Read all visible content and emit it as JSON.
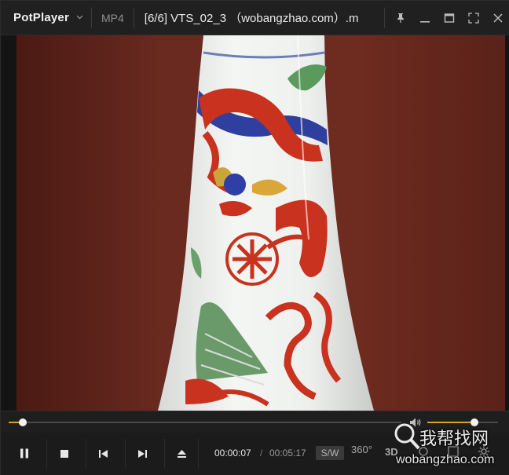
{
  "app": {
    "name": "PotPlayer",
    "format": "MP4",
    "title": "[6/6] VTS_02_3 （wobangzhao.com）.m"
  },
  "playback": {
    "current_time": "00:00:07",
    "separator": "/",
    "total_time": "00:05:17",
    "progress_fraction": 0.036,
    "volume_fraction": 0.67,
    "sw_label": "S/W",
    "label_360": "360°",
    "label_3d": "3D"
  },
  "watermark": {
    "line1": "我帮找网",
    "line2": "wobangzhao.com"
  },
  "icons": {
    "logo_menu": "chevron-down-icon",
    "pin": "pin-icon",
    "minimize": "minimize-icon",
    "maximize": "maximize-icon",
    "fullscreen": "fullscreen-icon",
    "close": "close-icon",
    "pause": "pause-icon",
    "stop": "stop-icon",
    "previous": "skip-previous-icon",
    "next": "skip-next-icon",
    "eject": "eject-icon",
    "volume": "volume-icon",
    "search": "magnifier-icon"
  },
  "colors": {
    "accent": "#d4a422",
    "titlebar": "#202020",
    "background": "#1b1b1b",
    "video_bg": "#6a2a20"
  }
}
